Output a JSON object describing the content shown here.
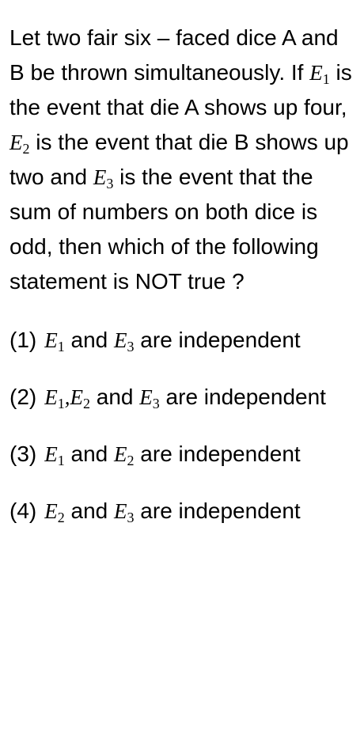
{
  "question": {
    "part1": "Let two fair six – faced dice A and B be thrown simultaneously. If ",
    "e1_var": "E",
    "e1_sub": "1",
    "part2": " is the event that die A shows up four, ",
    "e2_var": "E",
    "e2_sub": "2",
    "part3": " is the event that die B shows up two and ",
    "e3_var": "E",
    "e3_sub": "3",
    "part4": " is the event that the sum of numbers on both dice is odd, then which of the following statement is NOT true ?"
  },
  "options": [
    {
      "number": "(1)",
      "a_var": "E",
      "a_sub": "1",
      "join": " and ",
      "b_var": "E",
      "b_sub": "3",
      "tail": " are independent"
    },
    {
      "number": "(2)",
      "a_var": "E",
      "a_sub": "1",
      "comma": ",",
      "c_var": "E",
      "c_sub": "2",
      "join": " and ",
      "b_var": "E",
      "b_sub": "3",
      "tail": " are independent"
    },
    {
      "number": "(3)",
      "a_var": "E",
      "a_sub": "1",
      "join": " and ",
      "b_var": "E",
      "b_sub": "2",
      "tail": " are independent"
    },
    {
      "number": "(4)",
      "a_var": "E",
      "a_sub": "2",
      "join": " and ",
      "b_var": "E",
      "b_sub": "3",
      "tail": "  are independent"
    }
  ]
}
